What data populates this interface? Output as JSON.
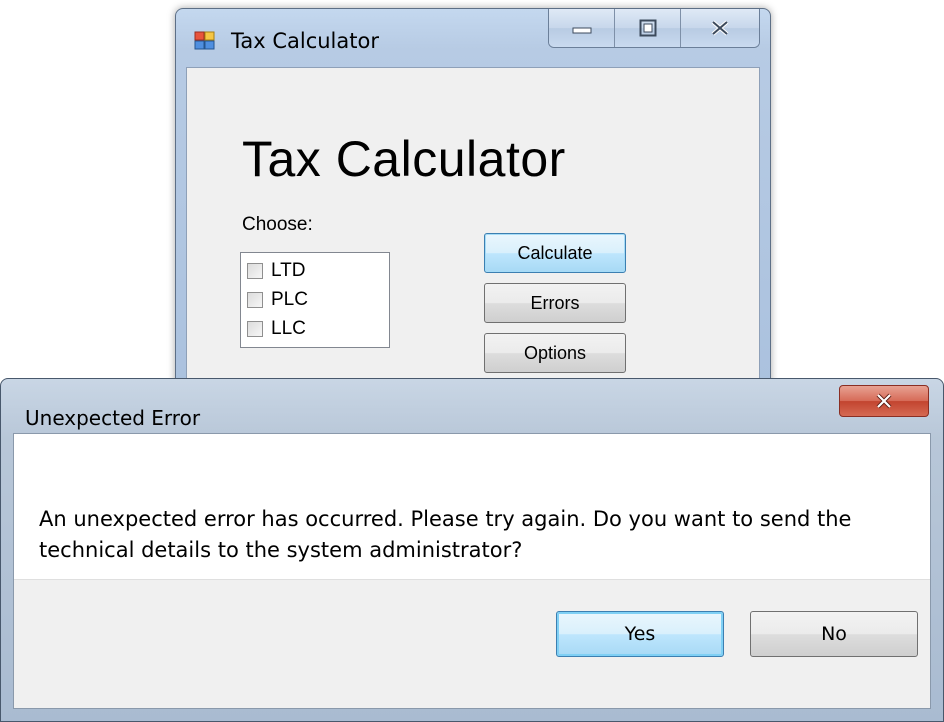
{
  "app": {
    "window_title": "Tax Calculator",
    "heading": "Tax Calculator",
    "choose_label": "Choose:",
    "options": [
      {
        "label": "LTD",
        "checked": false
      },
      {
        "label": "PLC",
        "checked": false
      },
      {
        "label": "LLC",
        "checked": false
      }
    ],
    "buttons": {
      "calculate": "Calculate",
      "errors": "Errors",
      "options": "Options"
    },
    "caption_buttons": [
      "minimize-icon",
      "maximize-icon",
      "close-icon"
    ]
  },
  "dialog": {
    "title": "Unexpected Error",
    "message": "An unexpected error has occurred. Please try again. Do you want to send the technical details to the system administrator?",
    "yes_label": "Yes",
    "no_label": "No",
    "close_icon": "close-icon"
  },
  "colors": {
    "frame_blue": "#b7cbe4",
    "default_button_border": "#3c7fb1",
    "close_red": "#c2442f",
    "client_gray": "#f0f0f0"
  }
}
